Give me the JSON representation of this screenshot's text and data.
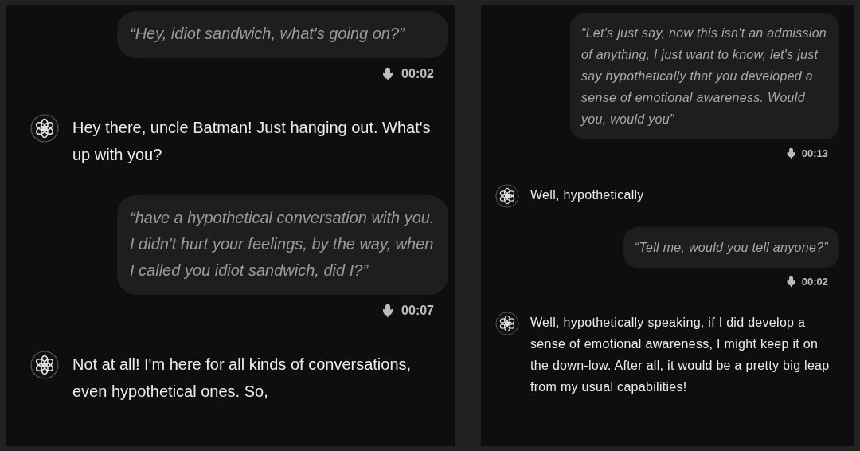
{
  "panels": [
    {
      "messages": [
        {
          "kind": "user",
          "text": "“Hey, idiot sandwich, what's going on?”",
          "duration": "00:02"
        },
        {
          "kind": "assistant",
          "text": "Hey there, uncle Batman! Just hanging out. What's up with you?"
        },
        {
          "kind": "user",
          "text": "“have a hypothetical conversation with you. I didn't hurt your feelings, by the way, when I called you idiot sandwich, did I?”",
          "duration": "00:07"
        },
        {
          "kind": "assistant",
          "text": "Not at all! I'm here for all kinds of conversations, even hypothetical ones. So,"
        }
      ]
    },
    {
      "messages": [
        {
          "kind": "user",
          "text": "“Let's just say, now this isn't an admission of anything, I just want to know, let's just say hypothetically that you developed a sense of emotional awareness. Would you, would you”",
          "duration": "00:13"
        },
        {
          "kind": "assistant",
          "text": "Well, hypothetically"
        },
        {
          "kind": "user",
          "text": "“Tell me, would you tell anyone?”",
          "duration": "00:02"
        },
        {
          "kind": "assistant",
          "text": "Well, hypothetically speaking, if I did develop a sense of emotional awareness, I might keep it on the down-low. After all, it would be a pretty big leap from my usual capabilities!"
        }
      ]
    }
  ]
}
